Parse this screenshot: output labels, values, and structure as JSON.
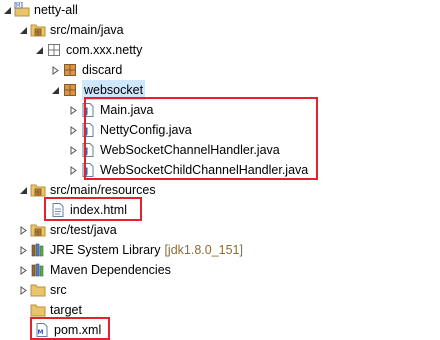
{
  "colors": {
    "highlight_box": "#e3222d",
    "selection": "#cfe6fb",
    "decoration": "#8a6d3b"
  },
  "tree": {
    "project": {
      "label": "netty-all",
      "icon": "maven-project-icon",
      "expanded": true
    },
    "src_main_java": {
      "label": "src/main/java",
      "icon": "source-folder-icon",
      "expanded": true
    },
    "package_root": {
      "label": "com.xxx.netty",
      "icon": "package-icon",
      "expanded": true
    },
    "package_discard": {
      "label": "discard",
      "icon": "package-icon",
      "expanded": false
    },
    "package_websocket": {
      "label": "websocket",
      "icon": "package-icon",
      "expanded": true,
      "selected": true
    },
    "files_websocket": [
      {
        "label": "Main.java",
        "icon": "java-file-icon"
      },
      {
        "label": "NettyConfig.java",
        "icon": "java-file-icon"
      },
      {
        "label": "WebSocketChannelHandler.java",
        "icon": "java-file-icon"
      },
      {
        "label": "WebSocketChildChannelHandler.java",
        "icon": "java-file-icon"
      }
    ],
    "src_main_resources": {
      "label": "src/main/resources",
      "icon": "source-folder-icon",
      "expanded": true
    },
    "index_html": {
      "label": "index.html",
      "icon": "html-file-icon"
    },
    "src_test_java": {
      "label": "src/test/java",
      "icon": "source-folder-icon",
      "expanded": false
    },
    "jre_library": {
      "label": "JRE System Library",
      "decoration": "[jdk1.8.0_151]",
      "icon": "library-icon",
      "expanded": false
    },
    "maven_deps": {
      "label": "Maven Dependencies",
      "icon": "library-icon",
      "expanded": false
    },
    "src": {
      "label": "src",
      "icon": "folder-icon",
      "expanded": false
    },
    "target": {
      "label": "target",
      "icon": "folder-icon"
    },
    "pom": {
      "label": "pom.xml",
      "icon": "xml-file-icon"
    }
  }
}
